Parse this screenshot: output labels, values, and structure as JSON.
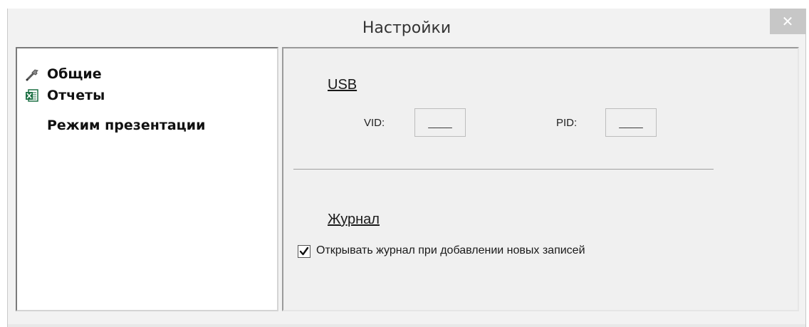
{
  "window": {
    "title": "Настройки",
    "close_label": "✕"
  },
  "sidebar": {
    "items": [
      {
        "label": "Общие",
        "icon": "wrench-icon"
      },
      {
        "label": "Отчеты",
        "icon": "excel-icon"
      },
      {
        "label": "Режим презентации",
        "icon": ""
      }
    ]
  },
  "usb": {
    "title": "USB",
    "vid_label": "VID:",
    "vid_value": "____",
    "pid_label": "PID:",
    "pid_value": "____"
  },
  "log": {
    "title": "Журнал",
    "open_on_new_label": "Открывать журнал при добавлении новых записей",
    "open_on_new_checked": true
  },
  "colors": {
    "window_bg": "#f2f2f2",
    "close_button_bg": "#c7c7c7",
    "panel_bg": "#f0f0f0",
    "excel_green": "#1e7145"
  }
}
